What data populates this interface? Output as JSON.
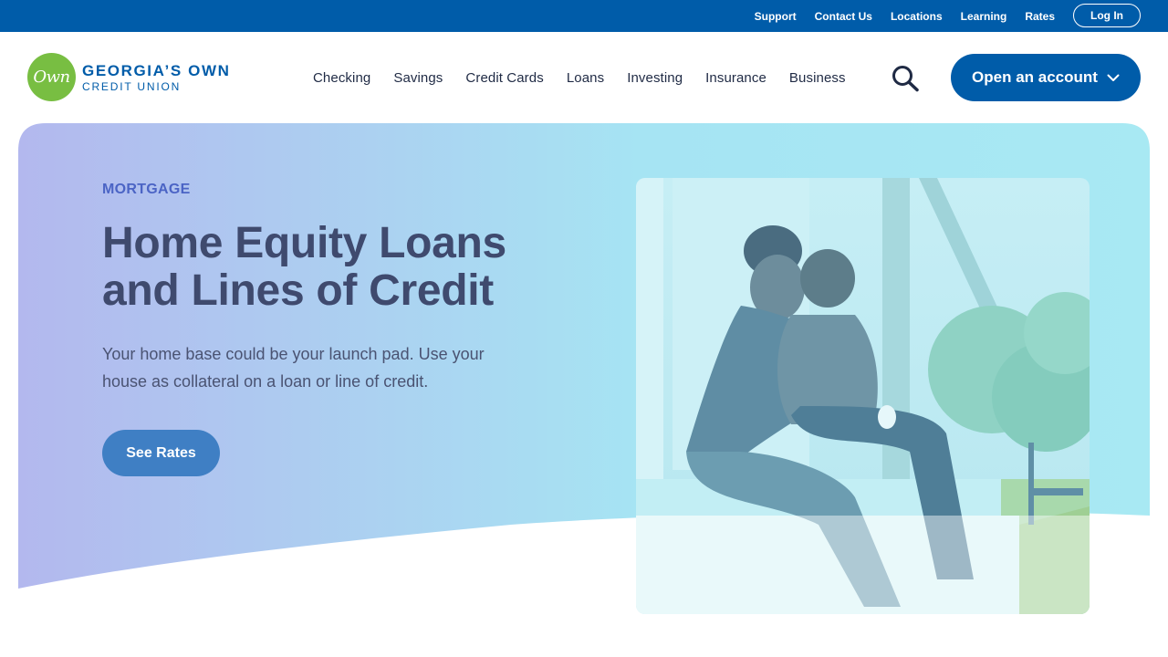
{
  "utility": {
    "links": [
      "Support",
      "Contact Us",
      "Locations",
      "Learning",
      "Rates"
    ],
    "login": "Log In"
  },
  "brand": {
    "logo_mark": "Own",
    "name_line1": "GEORGIA’S OWN",
    "name_line2": "CREDIT UNION"
  },
  "nav": {
    "items": [
      "Checking",
      "Savings",
      "Credit Cards",
      "Loans",
      "Investing",
      "Insurance",
      "Business"
    ],
    "search_icon": "search-icon",
    "open_account": "Open an account",
    "open_account_icon": "chevron-down-icon"
  },
  "hero": {
    "eyebrow": "MORTGAGE",
    "title": "Home Equity Loans and Lines of Credit",
    "subtitle": "Your home base could be your launch pad. Use your house as collateral on a loan or line of credit.",
    "cta": "See Rates"
  },
  "colors": {
    "brand_blue": "#005ca9",
    "logo_green": "#78be42",
    "cta_blue": "#3f7fc4",
    "gradient_start": "#b3b8ee",
    "gradient_end": "#a8e9f3"
  }
}
